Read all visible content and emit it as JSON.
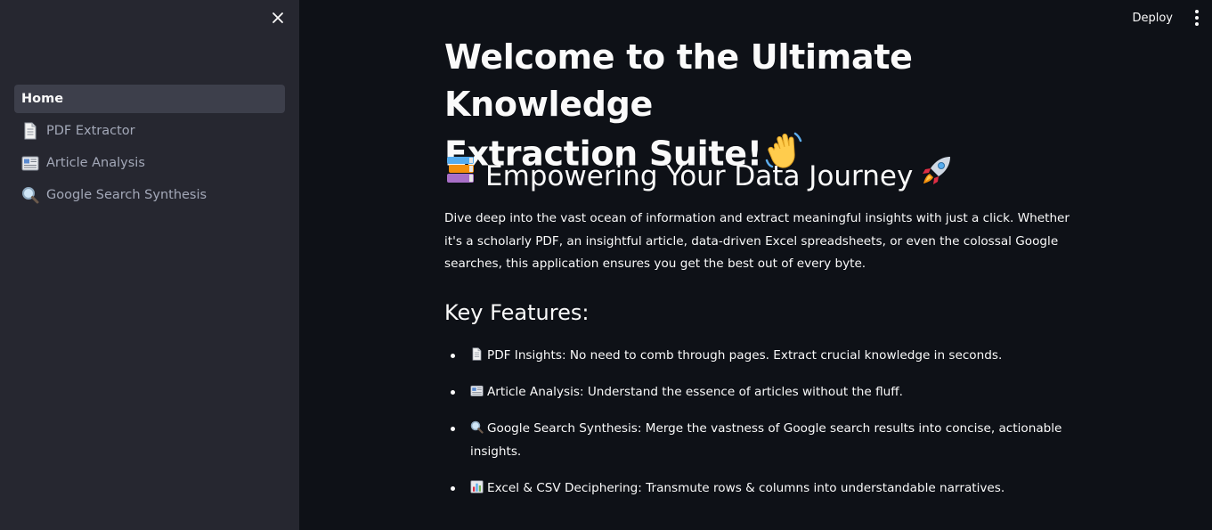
{
  "sidebar": {
    "items": [
      {
        "label": "Home",
        "icon": "",
        "active": true
      },
      {
        "label": "PDF Extractor",
        "icon": "page-facing-up-icon"
      },
      {
        "label": "Article Analysis",
        "icon": "newspaper-icon"
      },
      {
        "label": "Google Search Synthesis",
        "icon": "magnifying-glass-icon"
      }
    ]
  },
  "toolbar": {
    "deploy_label": "Deploy"
  },
  "main": {
    "title_line1": "Welcome to the Ultimate Knowledge",
    "title_line2": "Extraction Suite!",
    "title_emoji": "waving-hand-icon",
    "subtitle": "Empowering Your Data Journey",
    "subtitle_icons": [
      "books-icon",
      "rocket-icon"
    ],
    "intro": "Dive deep into the vast ocean of information and extract meaningful insights with just a click. Whether it's a scholarly PDF, an insightful article, data-driven Excel spreadsheets, or even the colossal Google searches, this application ensures you get the best out of every byte.",
    "features_heading": "Key Features:",
    "features": [
      {
        "icon": "page-facing-up-icon",
        "text": "PDF Insights: No need to comb through pages. Extract crucial knowledge in seconds."
      },
      {
        "icon": "newspaper-icon",
        "text": "Article Analysis: Understand the essence of articles without the fluff."
      },
      {
        "icon": "magnifying-glass-icon",
        "text": "Google Search Synthesis: Merge the vastness of Google search results into concise, actionable insights."
      },
      {
        "icon": "bar-chart-icon",
        "text": "Excel & CSV Deciphering: Transmute rows & columns into understandable narratives."
      }
    ]
  },
  "colors": {
    "background": "#0e1117",
    "sidebar": "#262730",
    "active_item": "#3d3f4b",
    "text": "#fafafa",
    "muted_text": "#a3a8b8"
  }
}
